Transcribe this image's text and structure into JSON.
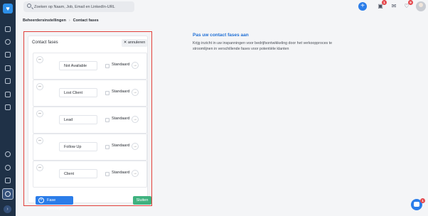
{
  "topbar": {
    "search_placeholder": "Zoeken op Naam, Job, Email en LinkedIn-URL",
    "add_label": "+",
    "notifications": [
      {
        "name": "gift-icon",
        "glyph": "✉",
        "badge": "1"
      },
      {
        "name": "mail-icon",
        "glyph": "✉",
        "badge": ""
      },
      {
        "name": "bell-icon",
        "glyph": "♥",
        "badge": "9"
      }
    ]
  },
  "breadcrumb": {
    "items": [
      "Beheerdersinstellingen",
      "Contact fases"
    ],
    "separator": "›"
  },
  "panel": {
    "title": "Contact fases",
    "cancel_label": "annuleren",
    "add_label": "Fase toevoegen",
    "close_label": "Sluiten",
    "standard_label": "Standaard",
    "stages": [
      "Not Available",
      "Lost Client",
      "Lead",
      "Follow Up",
      "Client"
    ]
  },
  "info": {
    "title": "Pas uw contact fases aan",
    "text": "Krijg inzicht in uw inspanningen voor bedrijfsontwikkeling door het verkoopproces te stroomlijnen in verschillende fases voor potentiële klanten"
  },
  "chat": {
    "badge": "1"
  },
  "colors": {
    "accent": "#2b7de9",
    "sidebar": "#1f3147",
    "highlight_border": "#e2403a",
    "close_button": "#3fb27f"
  }
}
